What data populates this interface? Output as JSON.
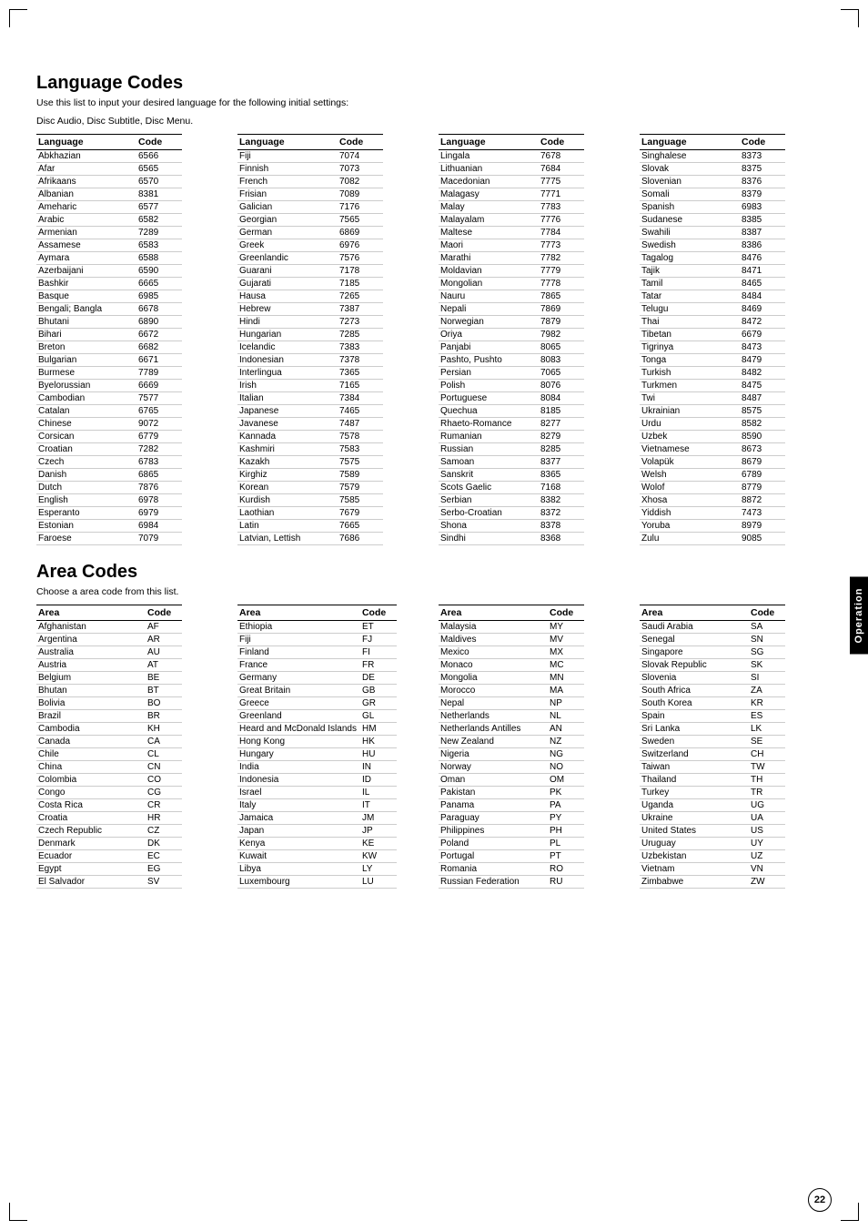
{
  "page": {
    "page_number": "22",
    "sidebar_label": "Operation"
  },
  "language_section": {
    "title": "Language Codes",
    "subtitle1": "Use this list to input your desired language for the following initial settings:",
    "subtitle2": "Disc Audio, Disc Subtitle, Disc Menu.",
    "col_header_lang": "Language",
    "col_header_code": "Code",
    "columns": [
      [
        {
          "lang": "Abkhazian",
          "code": "6566"
        },
        {
          "lang": "Afar",
          "code": "6565"
        },
        {
          "lang": "Afrikaans",
          "code": "6570"
        },
        {
          "lang": "Albanian",
          "code": "8381"
        },
        {
          "lang": "Ameharic",
          "code": "6577"
        },
        {
          "lang": "Arabic",
          "code": "6582"
        },
        {
          "lang": "Armenian",
          "code": "7289"
        },
        {
          "lang": "Assamese",
          "code": "6583"
        },
        {
          "lang": "Aymara",
          "code": "6588"
        },
        {
          "lang": "Azerbaijani",
          "code": "6590"
        },
        {
          "lang": "Bashkir",
          "code": "6665"
        },
        {
          "lang": "Basque",
          "code": "6985"
        },
        {
          "lang": "Bengali; Bangla",
          "code": "6678"
        },
        {
          "lang": "Bhutani",
          "code": "6890"
        },
        {
          "lang": "Bihari",
          "code": "6672"
        },
        {
          "lang": "Breton",
          "code": "6682"
        },
        {
          "lang": "Bulgarian",
          "code": "6671"
        },
        {
          "lang": "Burmese",
          "code": "7789"
        },
        {
          "lang": "Byelorussian",
          "code": "6669"
        },
        {
          "lang": "Cambodian",
          "code": "7577"
        },
        {
          "lang": "Catalan",
          "code": "6765"
        },
        {
          "lang": "Chinese",
          "code": "9072"
        },
        {
          "lang": "Corsican",
          "code": "6779"
        },
        {
          "lang": "Croatian",
          "code": "7282"
        },
        {
          "lang": "Czech",
          "code": "6783"
        },
        {
          "lang": "Danish",
          "code": "6865"
        },
        {
          "lang": "Dutch",
          "code": "7876"
        },
        {
          "lang": "English",
          "code": "6978"
        },
        {
          "lang": "Esperanto",
          "code": "6979"
        },
        {
          "lang": "Estonian",
          "code": "6984"
        },
        {
          "lang": "Faroese",
          "code": "7079"
        }
      ],
      [
        {
          "lang": "Fiji",
          "code": "7074"
        },
        {
          "lang": "Finnish",
          "code": "7073"
        },
        {
          "lang": "French",
          "code": "7082"
        },
        {
          "lang": "Frisian",
          "code": "7089"
        },
        {
          "lang": "Galician",
          "code": "7176"
        },
        {
          "lang": "Georgian",
          "code": "7565"
        },
        {
          "lang": "German",
          "code": "6869"
        },
        {
          "lang": "Greek",
          "code": "6976"
        },
        {
          "lang": "Greenlandic",
          "code": "7576"
        },
        {
          "lang": "Guarani",
          "code": "7178"
        },
        {
          "lang": "Gujarati",
          "code": "7185"
        },
        {
          "lang": "Hausa",
          "code": "7265"
        },
        {
          "lang": "Hebrew",
          "code": "7387"
        },
        {
          "lang": "Hindi",
          "code": "7273"
        },
        {
          "lang": "Hungarian",
          "code": "7285"
        },
        {
          "lang": "Icelandic",
          "code": "7383"
        },
        {
          "lang": "Indonesian",
          "code": "7378"
        },
        {
          "lang": "Interlingua",
          "code": "7365"
        },
        {
          "lang": "Irish",
          "code": "7165"
        },
        {
          "lang": "Italian",
          "code": "7384"
        },
        {
          "lang": "Japanese",
          "code": "7465"
        },
        {
          "lang": "Javanese",
          "code": "7487"
        },
        {
          "lang": "Kannada",
          "code": "7578"
        },
        {
          "lang": "Kashmiri",
          "code": "7583"
        },
        {
          "lang": "Kazakh",
          "code": "7575"
        },
        {
          "lang": "Kirghiz",
          "code": "7589"
        },
        {
          "lang": "Korean",
          "code": "7579"
        },
        {
          "lang": "Kurdish",
          "code": "7585"
        },
        {
          "lang": "Laothian",
          "code": "7679"
        },
        {
          "lang": "Latin",
          "code": "7665"
        },
        {
          "lang": "Latvian, Lettish",
          "code": "7686"
        }
      ],
      [
        {
          "lang": "Lingala",
          "code": "7678"
        },
        {
          "lang": "Lithuanian",
          "code": "7684"
        },
        {
          "lang": "Macedonian",
          "code": "7775"
        },
        {
          "lang": "Malagasy",
          "code": "7771"
        },
        {
          "lang": "Malay",
          "code": "7783"
        },
        {
          "lang": "Malayalam",
          "code": "7776"
        },
        {
          "lang": "Maltese",
          "code": "7784"
        },
        {
          "lang": "Maori",
          "code": "7773"
        },
        {
          "lang": "Marathi",
          "code": "7782"
        },
        {
          "lang": "Moldavian",
          "code": "7779"
        },
        {
          "lang": "Mongolian",
          "code": "7778"
        },
        {
          "lang": "Nauru",
          "code": "7865"
        },
        {
          "lang": "Nepali",
          "code": "7869"
        },
        {
          "lang": "Norwegian",
          "code": "7879"
        },
        {
          "lang": "Oriya",
          "code": "7982"
        },
        {
          "lang": "Panjabi",
          "code": "8065"
        },
        {
          "lang": "Pashto, Pushto",
          "code": "8083"
        },
        {
          "lang": "Persian",
          "code": "7065"
        },
        {
          "lang": "Polish",
          "code": "8076"
        },
        {
          "lang": "Portuguese",
          "code": "8084"
        },
        {
          "lang": "Quechua",
          "code": "8185"
        },
        {
          "lang": "Rhaeto-Romance",
          "code": "8277"
        },
        {
          "lang": "Rumanian",
          "code": "8279"
        },
        {
          "lang": "Russian",
          "code": "8285"
        },
        {
          "lang": "Samoan",
          "code": "8377"
        },
        {
          "lang": "Sanskrit",
          "code": "8365"
        },
        {
          "lang": "Scots Gaelic",
          "code": "7168"
        },
        {
          "lang": "Serbian",
          "code": "8382"
        },
        {
          "lang": "Serbo-Croatian",
          "code": "8372"
        },
        {
          "lang": "Shona",
          "code": "8378"
        },
        {
          "lang": "Sindhi",
          "code": "8368"
        }
      ],
      [
        {
          "lang": "Singhalese",
          "code": "8373"
        },
        {
          "lang": "Slovak",
          "code": "8375"
        },
        {
          "lang": "Slovenian",
          "code": "8376"
        },
        {
          "lang": "Somali",
          "code": "8379"
        },
        {
          "lang": "Spanish",
          "code": "6983"
        },
        {
          "lang": "Sudanese",
          "code": "8385"
        },
        {
          "lang": "Swahili",
          "code": "8387"
        },
        {
          "lang": "Swedish",
          "code": "8386"
        },
        {
          "lang": "Tagalog",
          "code": "8476"
        },
        {
          "lang": "Tajik",
          "code": "8471"
        },
        {
          "lang": "Tamil",
          "code": "8465"
        },
        {
          "lang": "Tatar",
          "code": "8484"
        },
        {
          "lang": "Telugu",
          "code": "8469"
        },
        {
          "lang": "Thai",
          "code": "8472"
        },
        {
          "lang": "Tibetan",
          "code": "6679"
        },
        {
          "lang": "Tigrinya",
          "code": "8473"
        },
        {
          "lang": "Tonga",
          "code": "8479"
        },
        {
          "lang": "Turkish",
          "code": "8482"
        },
        {
          "lang": "Turkmen",
          "code": "8475"
        },
        {
          "lang": "Twi",
          "code": "8487"
        },
        {
          "lang": "Ukrainian",
          "code": "8575"
        },
        {
          "lang": "Urdu",
          "code": "8582"
        },
        {
          "lang": "Uzbek",
          "code": "8590"
        },
        {
          "lang": "Vietnamese",
          "code": "8673"
        },
        {
          "lang": "Volapük",
          "code": "8679"
        },
        {
          "lang": "Welsh",
          "code": "6789"
        },
        {
          "lang": "Wolof",
          "code": "8779"
        },
        {
          "lang": "Xhosa",
          "code": "8872"
        },
        {
          "lang": "Yiddish",
          "code": "7473"
        },
        {
          "lang": "Yoruba",
          "code": "8979"
        },
        {
          "lang": "Zulu",
          "code": "9085"
        }
      ]
    ]
  },
  "area_section": {
    "title": "Area Codes",
    "subtitle": "Choose a area code from this list.",
    "col_header_area": "Area",
    "col_header_code": "Code",
    "columns": [
      [
        {
          "area": "Afghanistan",
          "code": "AF"
        },
        {
          "area": "Argentina",
          "code": "AR"
        },
        {
          "area": "Australia",
          "code": "AU"
        },
        {
          "area": "Austria",
          "code": "AT"
        },
        {
          "area": "Belgium",
          "code": "BE"
        },
        {
          "area": "Bhutan",
          "code": "BT"
        },
        {
          "area": "Bolivia",
          "code": "BO"
        },
        {
          "area": "Brazil",
          "code": "BR"
        },
        {
          "area": "Cambodia",
          "code": "KH"
        },
        {
          "area": "Canada",
          "code": "CA"
        },
        {
          "area": "Chile",
          "code": "CL"
        },
        {
          "area": "China",
          "code": "CN"
        },
        {
          "area": "Colombia",
          "code": "CO"
        },
        {
          "area": "Congo",
          "code": "CG"
        },
        {
          "area": "Costa Rica",
          "code": "CR"
        },
        {
          "area": "Croatia",
          "code": "HR"
        },
        {
          "area": "Czech Republic",
          "code": "CZ"
        },
        {
          "area": "Denmark",
          "code": "DK"
        },
        {
          "area": "Ecuador",
          "code": "EC"
        },
        {
          "area": "Egypt",
          "code": "EG"
        },
        {
          "area": "El Salvador",
          "code": "SV"
        }
      ],
      [
        {
          "area": "Ethiopia",
          "code": "ET"
        },
        {
          "area": "Fiji",
          "code": "FJ"
        },
        {
          "area": "Finland",
          "code": "FI"
        },
        {
          "area": "France",
          "code": "FR"
        },
        {
          "area": "Germany",
          "code": "DE"
        },
        {
          "area": "Great Britain",
          "code": "GB"
        },
        {
          "area": "Greece",
          "code": "GR"
        },
        {
          "area": "Greenland",
          "code": "GL"
        },
        {
          "area": "Heard and McDonald Islands",
          "code": "HM"
        },
        {
          "area": "Hong Kong",
          "code": "HK"
        },
        {
          "area": "Hungary",
          "code": "HU"
        },
        {
          "area": "India",
          "code": "IN"
        },
        {
          "area": "Indonesia",
          "code": "ID"
        },
        {
          "area": "Israel",
          "code": "IL"
        },
        {
          "area": "Italy",
          "code": "IT"
        },
        {
          "area": "Jamaica",
          "code": "JM"
        },
        {
          "area": "Japan",
          "code": "JP"
        },
        {
          "area": "Kenya",
          "code": "KE"
        },
        {
          "area": "Kuwait",
          "code": "KW"
        },
        {
          "area": "Libya",
          "code": "LY"
        },
        {
          "area": "Luxembourg",
          "code": "LU"
        }
      ],
      [
        {
          "area": "Malaysia",
          "code": "MY"
        },
        {
          "area": "Maldives",
          "code": "MV"
        },
        {
          "area": "Mexico",
          "code": "MX"
        },
        {
          "area": "Monaco",
          "code": "MC"
        },
        {
          "area": "Mongolia",
          "code": "MN"
        },
        {
          "area": "Morocco",
          "code": "MA"
        },
        {
          "area": "Nepal",
          "code": "NP"
        },
        {
          "area": "Netherlands",
          "code": "NL"
        },
        {
          "area": "Netherlands Antilles",
          "code": "AN"
        },
        {
          "area": "New Zealand",
          "code": "NZ"
        },
        {
          "area": "Nigeria",
          "code": "NG"
        },
        {
          "area": "Norway",
          "code": "NO"
        },
        {
          "area": "Oman",
          "code": "OM"
        },
        {
          "area": "Pakistan",
          "code": "PK"
        },
        {
          "area": "Panama",
          "code": "PA"
        },
        {
          "area": "Paraguay",
          "code": "PY"
        },
        {
          "area": "Philippines",
          "code": "PH"
        },
        {
          "area": "Poland",
          "code": "PL"
        },
        {
          "area": "Portugal",
          "code": "PT"
        },
        {
          "area": "Romania",
          "code": "RO"
        },
        {
          "area": "Russian Federation",
          "code": "RU"
        }
      ],
      [
        {
          "area": "Saudi Arabia",
          "code": "SA"
        },
        {
          "area": "Senegal",
          "code": "SN"
        },
        {
          "area": "Singapore",
          "code": "SG"
        },
        {
          "area": "Slovak Republic",
          "code": "SK"
        },
        {
          "area": "Slovenia",
          "code": "SI"
        },
        {
          "area": "South Africa",
          "code": "ZA"
        },
        {
          "area": "South Korea",
          "code": "KR"
        },
        {
          "area": "Spain",
          "code": "ES"
        },
        {
          "area": "Sri Lanka",
          "code": "LK"
        },
        {
          "area": "Sweden",
          "code": "SE"
        },
        {
          "area": "Switzerland",
          "code": "CH"
        },
        {
          "area": "Taiwan",
          "code": "TW"
        },
        {
          "area": "Thailand",
          "code": "TH"
        },
        {
          "area": "Turkey",
          "code": "TR"
        },
        {
          "area": "Uganda",
          "code": "UG"
        },
        {
          "area": "Ukraine",
          "code": "UA"
        },
        {
          "area": "United States",
          "code": "US"
        },
        {
          "area": "Uruguay",
          "code": "UY"
        },
        {
          "area": "Uzbekistan",
          "code": "UZ"
        },
        {
          "area": "Vietnam",
          "code": "VN"
        },
        {
          "area": "Zimbabwe",
          "code": "ZW"
        }
      ]
    ]
  }
}
